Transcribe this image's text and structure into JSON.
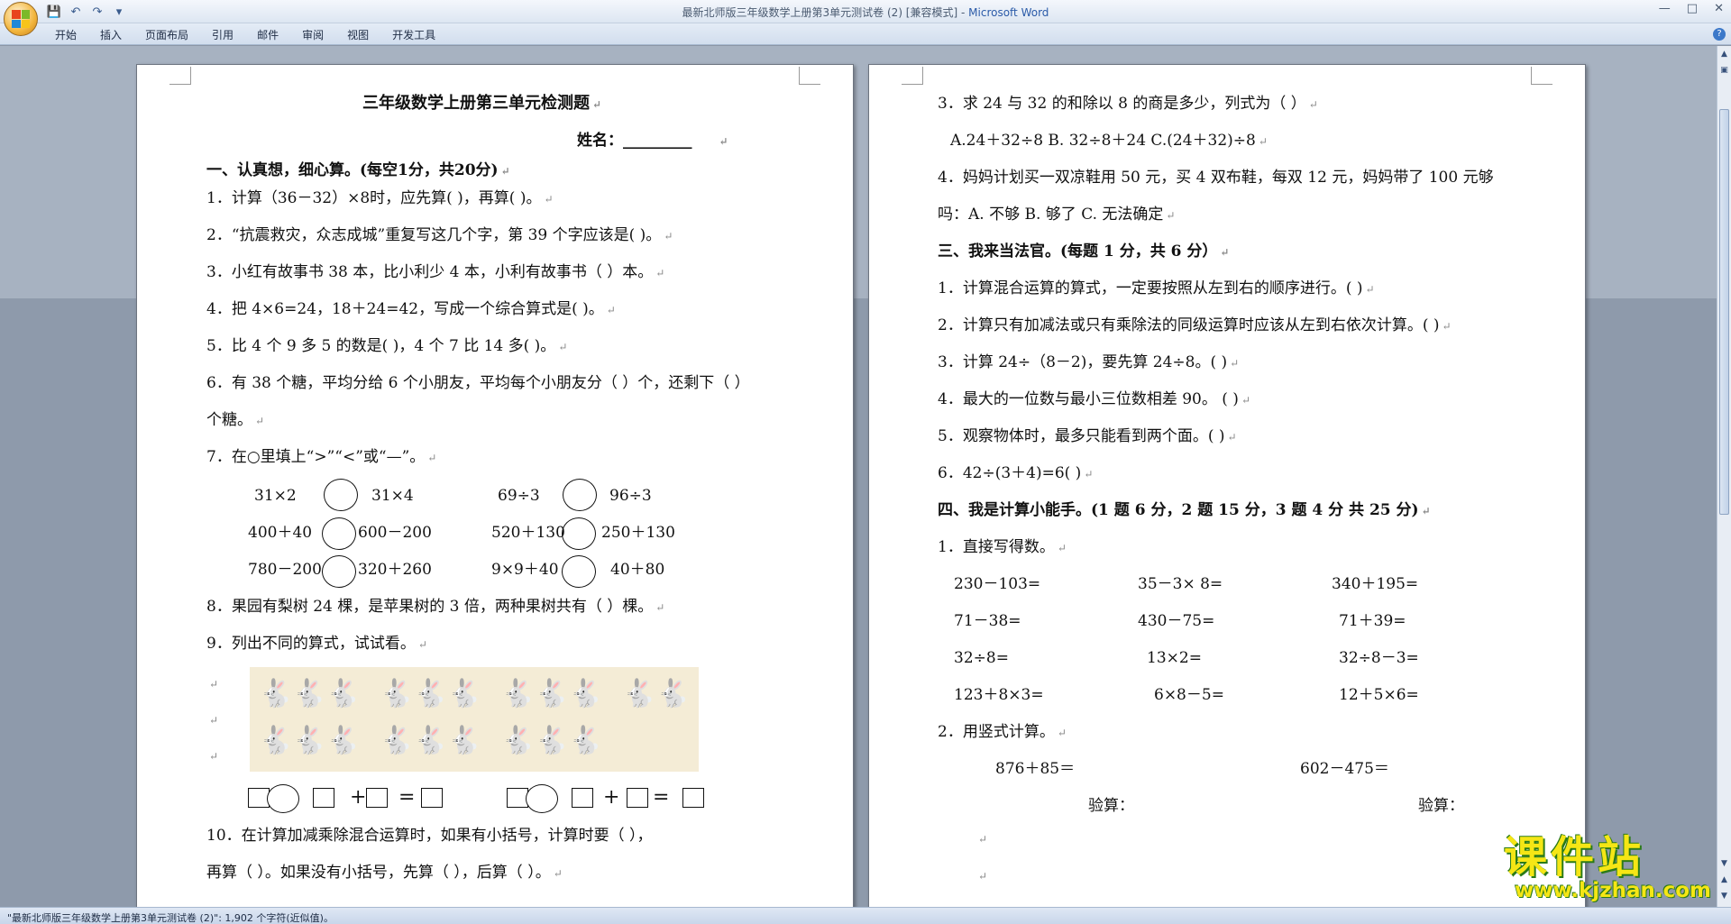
{
  "window": {
    "title": "最新北师版三年级数学上册第3单元测试卷 (2) [兼容模式]",
    "app_name": "Microsoft Word",
    "quick_access": [
      "save-icon",
      "undo-icon",
      "redo-icon",
      "customize-icon"
    ]
  },
  "ribbon": {
    "tabs": [
      "开始",
      "插入",
      "页面布局",
      "引用",
      "邮件",
      "审阅",
      "视图",
      "开发工具"
    ]
  },
  "page1": {
    "title": "三年级数学上册第三单元检测题",
    "name_label": "姓名：_________",
    "section1": "一、认真想，细心算。(每空1分，共20分)",
    "q1": "1．计算（36－32）×8时，应先算(     )，再算(     )。",
    "q2": "2．“抗震救灾，众志成城”重复写这几个字，第 39 个字应该是(  )。",
    "q3": "3．小红有故事书 38 本，比小利少 4 本，小利有故事书（     ）本。",
    "q4": "4．把 4×6=24，18＋24=42，写成一个综合算式是(                          )。",
    "q5": "5．比 4 个 9 多 5 的数是(   )，4 个 7 比 14 多(     )。",
    "q6a": "6．有 38 个糖，平均分给 6 个小朋友，平均每个小朋友分（   ）个，还剩下（   ）",
    "q6b": "个糖。",
    "q7": "7．在○里填上“>”“<”或“—”。",
    "compare": [
      [
        "31×2",
        "31×4",
        "69÷3",
        "96÷3"
      ],
      [
        "400＋40",
        "600－200",
        "520＋130",
        "250＋130"
      ],
      [
        "780－200",
        "320＋260",
        "9×9＋40",
        "40＋80"
      ]
    ],
    "q8": "8．果园有梨树 24 棵，是苹果树的 3 倍，两种果树共有（     ）棵。",
    "q9": "9．列出不同的算式，试试看。",
    "q10a": "10．在计算加减乘除混合运算时，如果有小括号，计算时要（                  ），",
    "q10b": "再算（            ）。如果没有小括号，先算（        ），后算（        ）。"
  },
  "page2": {
    "q3": "3．求 24 与 32 的和除以 8 的商是多少，列式为（     ）",
    "q3_options": "A.24＋32÷8        B. 32÷8＋24      C.(24＋32)÷8",
    "q4a": "4．妈妈计划买一双凉鞋用 50 元，买 4 双布鞋，每双 12 元，妈妈带了 100 元够",
    "q4b": "吗：A. 不够          B. 够了      C. 无法确定",
    "section3": "三、我来当法官。(每题 1 分，共 6 分）",
    "s3": [
      "1．计算混合运算的算式，一定要按照从左到右的顺序进行。(  )",
      "2．计算只有加减法或只有乘除法的同级运算时应该从左到右依次计算。(     )",
      "3．计算 24÷（8－2)，要先算 24÷8。(  )",
      "4．最大的一位数与最小三位数相差 90。      (     )",
      "5．观察物体时，最多只能看到两个面。(    )",
      "6．42÷(3＋4)=6(     )"
    ],
    "section4": "四、我是计算小能手。(1 题 6 分，2 题 15 分，3 题 4 分 共 25 分)",
    "s4_q1": "1．直接写得数。",
    "calc": [
      [
        "230－103=",
        "35－3× 8=",
        "340＋195="
      ],
      [
        "71－38=",
        "430－75=",
        "71＋39="
      ],
      [
        "32÷8=",
        "13×2=",
        "32÷8－3="
      ],
      [
        "123＋8×3=",
        "6×8－5=",
        "12＋5×6="
      ]
    ],
    "s4_q2": "2．用竖式计算。",
    "vertical": [
      "876＋85＝",
      "602－475＝"
    ],
    "check_label": "验算："
  },
  "status": {
    "text": "\"最新北师版三年级数学上册第3单元测试卷 (2)\": 1,902 个字符(近似值)。"
  },
  "watermark": {
    "brand": "课件站",
    "url": "www.kjzhan.com"
  },
  "colors": {
    "workspace": "#a7b2c1",
    "ribbon": "#d2deee",
    "watermark_yellow": "#f5e615",
    "watermark_green": "#2a7a18"
  }
}
